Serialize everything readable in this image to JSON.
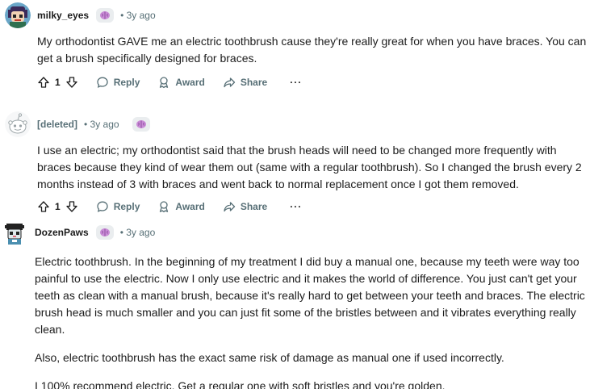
{
  "comments": [
    {
      "author": "milky_eyes",
      "time": "• 3y ago",
      "body": [
        "My orthodontist GAVE me an electric toothbrush cause they're really great for when you have braces. You can get a brush specifically designed for braces."
      ],
      "votes": "1"
    },
    {
      "author": "[deleted]",
      "time": "• 3y ago",
      "body": [
        "I use an electric; my orthodontist said that the brush heads will need to be changed more frequently with braces because they kind of wear them out (same with a regular toothbrush). So I changed the brush every 2 months instead of 3 with braces and went back to normal replacement once I got them removed."
      ],
      "votes": "1"
    },
    {
      "author": "DozenPaws",
      "time": "• 3y ago",
      "body": [
        "Electric toothbrush. In the beginning of my treatment I did buy a manual one, because my teeth were way too painful to use the electric. Now I only use electric and it makes the world of difference. You just can't get your teeth as clean with a manual brush, because it's really hard to get between your teeth and braces. The electric brush head is much smaller and you can just fit some of the bristles between and it vibrates everything really clean.",
        "Also, electric toothbrush has the exact same risk of damage as manual one if used incorrectly.",
        "I 100% recommend electric. Get a regular one with soft bristles and you're golden."
      ]
    }
  ],
  "actions": {
    "reply": "Reply",
    "award": "Award",
    "share": "Share",
    "more": "···"
  },
  "icons": {
    "upvote": "upvote-arrow-icon",
    "downvote": "downvote-arrow-icon",
    "reply": "speech-bubble-icon",
    "award": "award-ribbon-icon",
    "share": "share-arrow-icon",
    "flair": "brain-flair-icon"
  },
  "colors": {
    "text": "#1c1c1c",
    "muted": "#576f76",
    "flair_bg": "#eaedef",
    "flair_brain": "#c98bd6"
  }
}
